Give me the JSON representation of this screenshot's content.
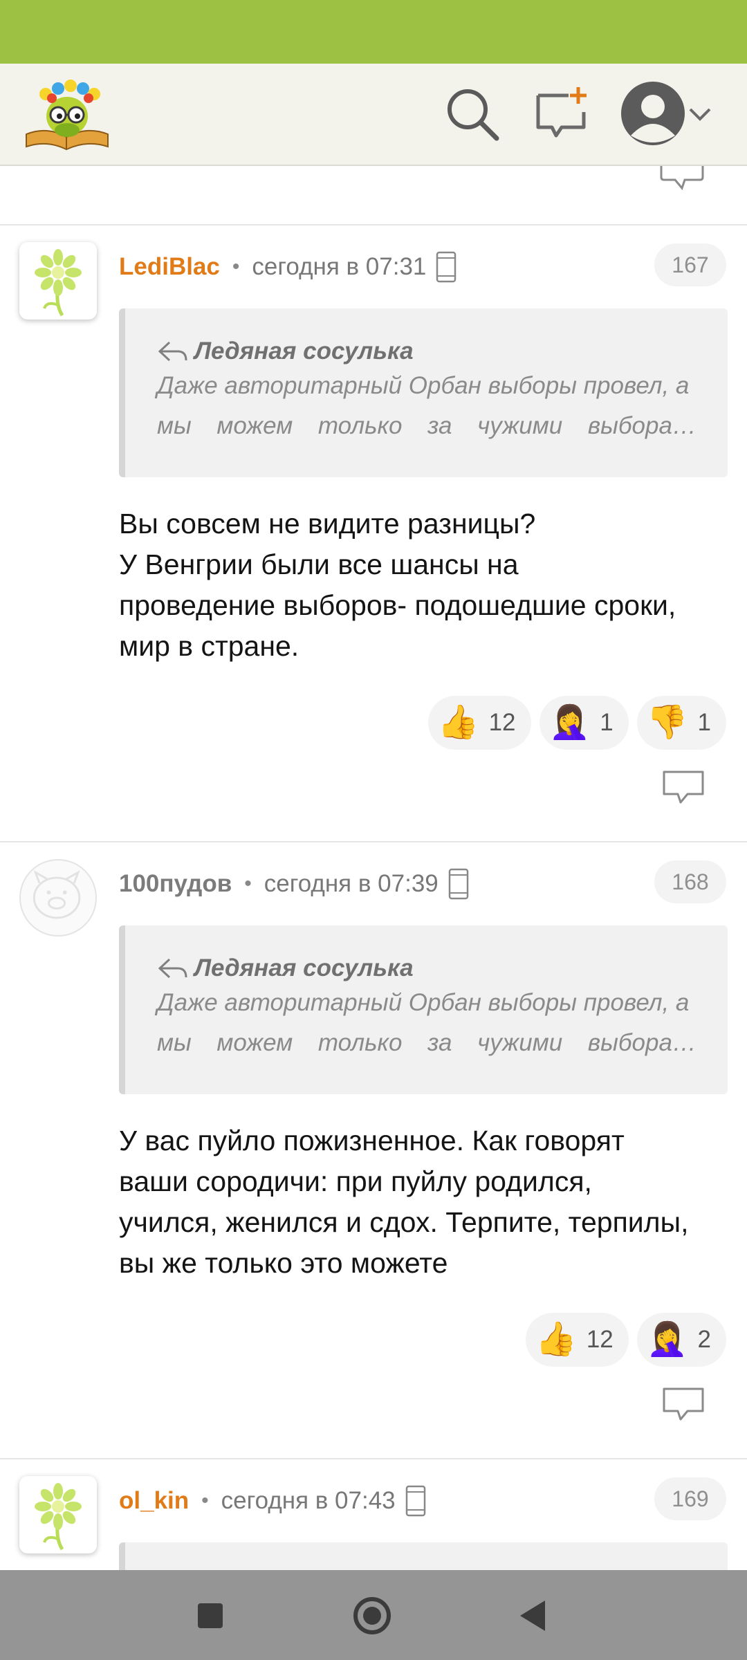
{
  "header": {
    "logo_alt": "site-logo",
    "icons": [
      "search-icon",
      "new-message-icon",
      "user-avatar-icon",
      "chevron-down-icon"
    ]
  },
  "comments": [
    {
      "author": "LediBlac",
      "time": "сегодня в 07:31",
      "number": "167",
      "quote_author": "Ледяная сосулька",
      "quote_line1": "Даже авторитарный Орбан выборы провел, а",
      "quote_line2_words": [
        "мы",
        "можем",
        "только",
        "за",
        "чужими",
        "выбора…"
      ],
      "body": [
        "Вы совсем не видите разницы?",
        "У Венгрии были все шансы на",
        "проведение выборов- подошедшие сроки,",
        "мир в стране."
      ],
      "reactions": [
        {
          "emoji": "👍",
          "count": "12"
        },
        {
          "emoji": "🤦‍♀️",
          "count": "1"
        },
        {
          "emoji": "👎",
          "count": "1"
        }
      ]
    },
    {
      "author": "100пудов",
      "time": "сегодня в 07:39",
      "number": "168",
      "quote_author": "Ледяная сосулька",
      "quote_line1": "Даже авторитарный Орбан выборы провел, а",
      "quote_line2_words": [
        "мы",
        "можем",
        "только",
        "за",
        "чужими",
        "выбора…"
      ],
      "body": [
        "У вас пуйло пожизненное. Как говорят",
        "ваши сородичи: при пуйлу родился,",
        "учился, женился и сдох. Терпите, терпилы,",
        "вы же только это можете"
      ],
      "reactions": [
        {
          "emoji": "👍",
          "count": "12"
        },
        {
          "emoji": "🤦‍♀️",
          "count": "2"
        }
      ]
    },
    {
      "author": "ol_kin",
      "time": "сегодня в 07:43",
      "number": "169"
    }
  ],
  "nav": [
    "recents-button",
    "home-button",
    "back-button"
  ],
  "colors": {
    "status_bar": "#9dc142",
    "header_bg": "#f3f3ec",
    "author": "#e07b18",
    "nav_bar": "#959595"
  }
}
